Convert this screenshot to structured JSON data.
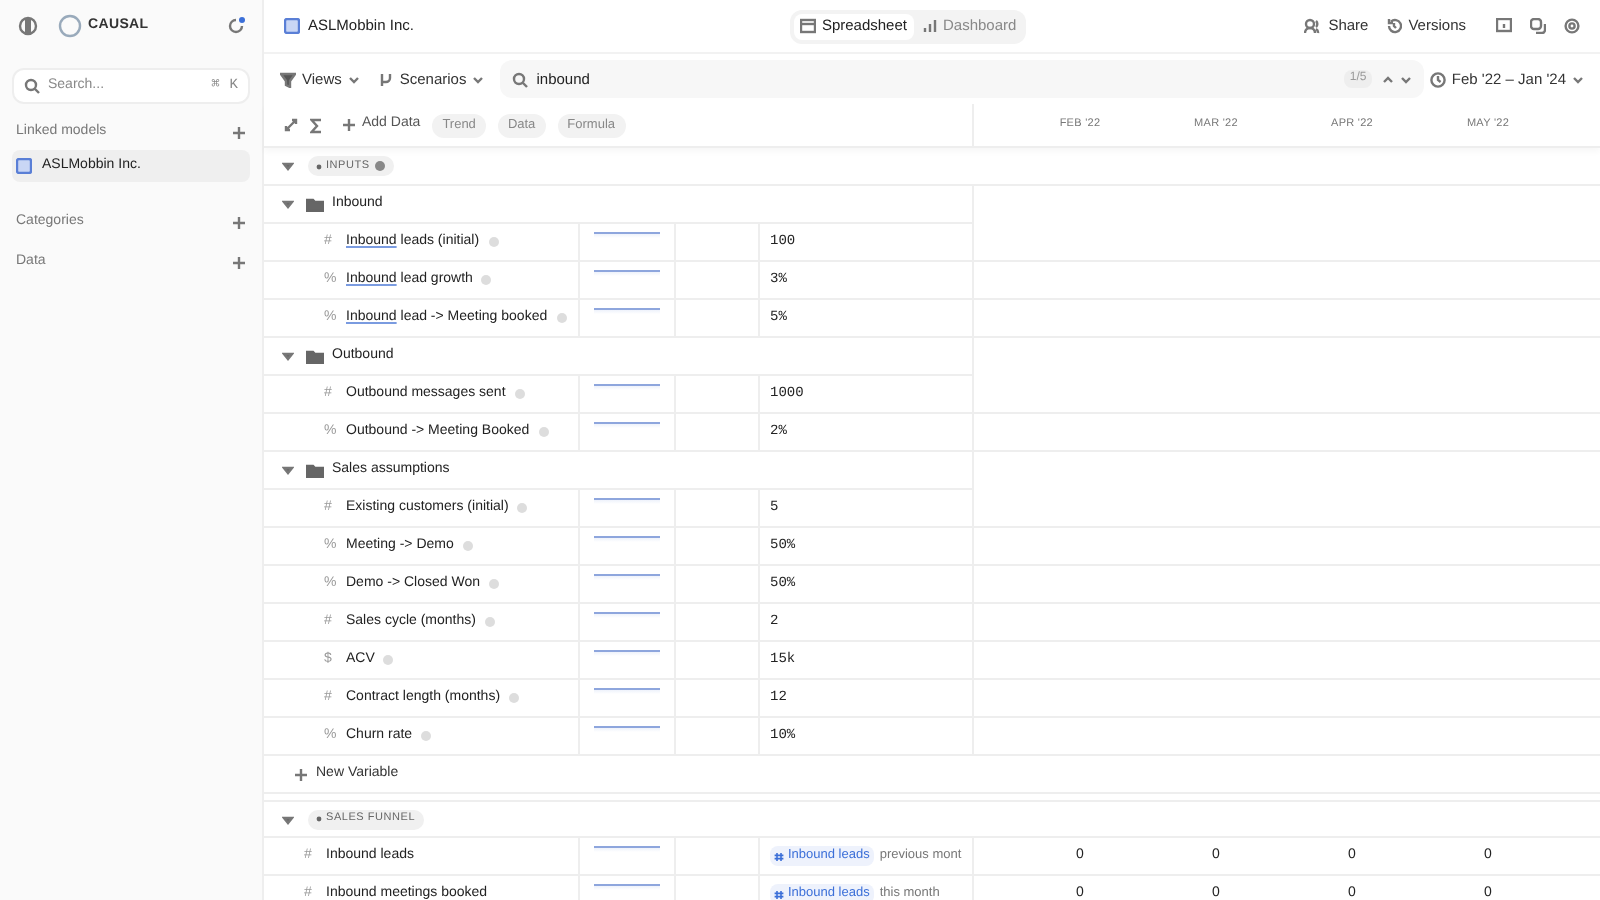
{
  "sidebar": {
    "brand": "CAUSAL",
    "search": {
      "placeholder": "Search...",
      "shortcut": [
        "⌘",
        "K"
      ]
    },
    "sections": [
      {
        "title": "Linked models",
        "items": [
          {
            "label": "ASLMobbin Inc.",
            "selected": true
          }
        ]
      },
      {
        "title": "Categories"
      },
      {
        "title": "Data"
      }
    ]
  },
  "header": {
    "model": "ASLMobbin Inc.",
    "tabs": [
      {
        "label": "Spreadsheet",
        "selected": true
      },
      {
        "label": "Dashboard",
        "selected": false
      }
    ],
    "share": "Share",
    "versions": "Versions"
  },
  "toolbar": {
    "views": "Views",
    "scenarios": "Scenarios",
    "search": {
      "value": "inbound",
      "count": "1/5"
    },
    "date_range": "Feb '22 – Jan '24"
  },
  "subtoolbar": {
    "add": "Add Data",
    "chips": [
      "Trend",
      "Data",
      "Formula"
    ],
    "months": [
      "FEB '22",
      "MAR '22",
      "APR '22",
      "MAY '22"
    ]
  },
  "sections": [
    {
      "title": "INPUTS",
      "expanded": true,
      "groups": [
        {
          "name": "Inbound",
          "expanded": true,
          "variables": [
            {
              "symbol": "#",
              "match": "Inbound",
              "rest": " leads (initial)",
              "value": "100"
            },
            {
              "symbol": "%",
              "match": "Inbound",
              "rest": " lead growth",
              "value": "3%"
            },
            {
              "symbol": "%",
              "match": "Inbound",
              "rest": " lead -> Meeting booked",
              "value": "5%"
            }
          ]
        },
        {
          "name": "Outbound",
          "expanded": true,
          "variables": [
            {
              "symbol": "#",
              "rest": "Outbound messages sent",
              "value": "1000"
            },
            {
              "symbol": "%",
              "rest": "Outbound -> Meeting Booked",
              "value": "2%"
            }
          ]
        },
        {
          "name": "Sales assumptions",
          "expanded": true,
          "variables": [
            {
              "symbol": "#",
              "rest": "Existing customers (initial)",
              "value": "5"
            },
            {
              "symbol": "%",
              "rest": "Meeting -> Demo",
              "value": "50%"
            },
            {
              "symbol": "%",
              "rest": "Demo -> Closed Won",
              "value": "50%"
            },
            {
              "symbol": "#",
              "rest": "Sales cycle (months)",
              "value": "2"
            },
            {
              "symbol": "$",
              "rest": "ACV",
              "value": "15k"
            },
            {
              "symbol": "#",
              "rest": "Contract length (months)",
              "value": "12"
            },
            {
              "symbol": "%",
              "rest": "Churn rate",
              "value": "10%"
            }
          ]
        }
      ],
      "new_variable": "New Variable"
    },
    {
      "title": "SALES FUNNEL",
      "expanded": true,
      "formulas": [
        {
          "symbol": "#",
          "name": "Inbound leads",
          "token": "Inbound leads",
          "rest": "previous mont",
          "values": [
            "0",
            "0",
            "0",
            "0"
          ]
        },
        {
          "symbol": "#",
          "name": "Inbound meetings booked",
          "token": "Inbound leads",
          "rest": "this month",
          "values": [
            "0",
            "0",
            "0",
            "0"
          ]
        }
      ]
    }
  ]
}
